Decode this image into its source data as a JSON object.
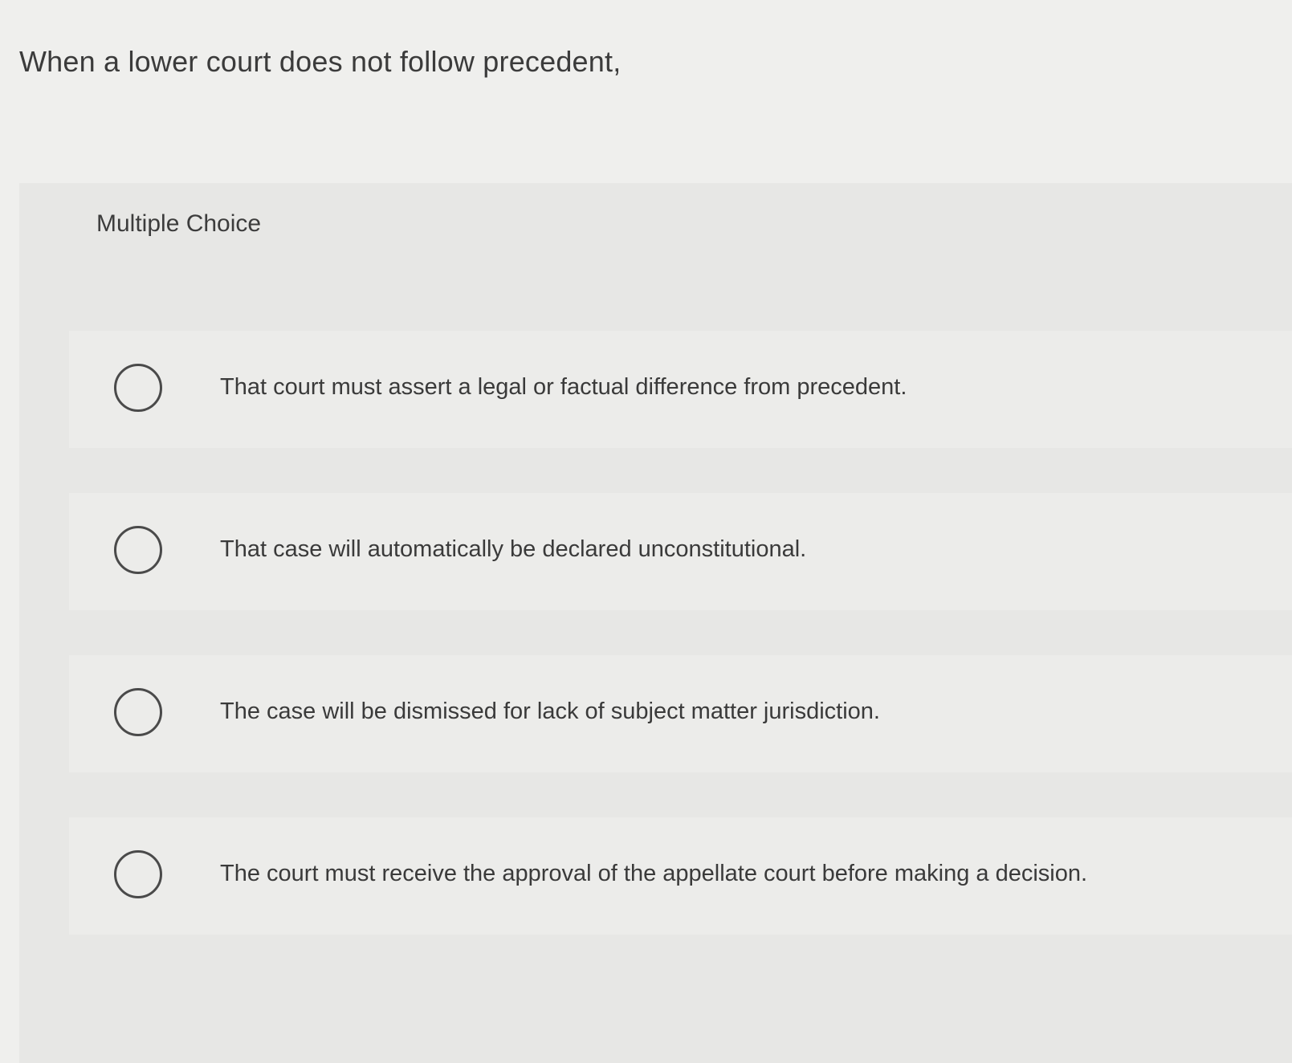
{
  "question": {
    "text": "When a lower court does not follow precedent,"
  },
  "question_type": {
    "label": "Multiple Choice"
  },
  "options": [
    {
      "text": "That court must assert a legal or factual difference from precedent.",
      "selected": false
    },
    {
      "text": "That case will automatically be declared unconstitutional.",
      "selected": false
    },
    {
      "text": "The case will be dismissed for lack of subject matter jurisdiction.",
      "selected": false
    },
    {
      "text": "The court must receive the approval of the appellate court before making a decision.",
      "selected": false
    }
  ],
  "colors": {
    "page_background": "#efefed",
    "panel_background": "#e7e7e5",
    "option_background": "#ececea",
    "text": "#3a3a3a",
    "radio_border": "#4a4a4a"
  }
}
